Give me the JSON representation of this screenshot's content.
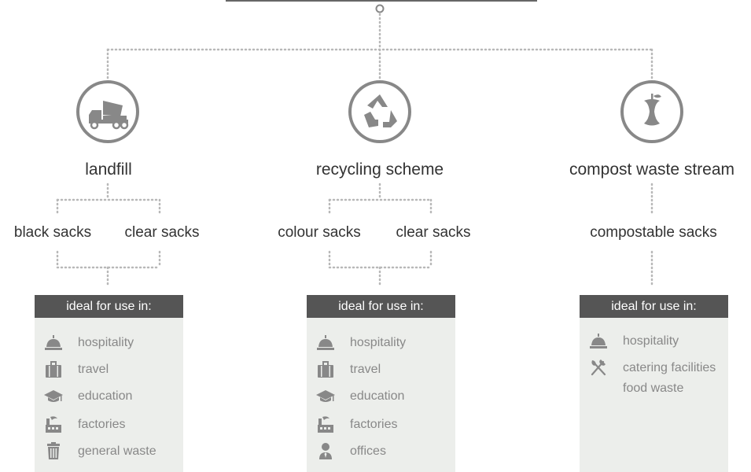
{
  "colors": {
    "dotted_line": "#b8b8b8",
    "icon": "#888888",
    "card_header_bg": "#555555",
    "card_bg": "#eceeeb",
    "item_text": "#888888"
  },
  "columns": [
    {
      "heading": "landfill",
      "icon": "dump-truck-icon",
      "sacks": [
        "black sacks",
        "clear sacks"
      ],
      "card": {
        "header": "ideal for use in:",
        "items": [
          {
            "icon": "service-bell-icon",
            "label": "hospitality"
          },
          {
            "icon": "suitcase-icon",
            "label": "travel"
          },
          {
            "icon": "graduation-cap-icon",
            "label": "education"
          },
          {
            "icon": "factory-icon",
            "label": "factories"
          },
          {
            "icon": "trash-bin-icon",
            "label": "general waste"
          }
        ]
      }
    },
    {
      "heading": "recycling scheme",
      "icon": "recycle-icon",
      "sacks": [
        "colour sacks",
        "clear sacks"
      ],
      "card": {
        "header": "ideal for use in:",
        "items": [
          {
            "icon": "service-bell-icon",
            "label": "hospitality"
          },
          {
            "icon": "suitcase-icon",
            "label": "travel"
          },
          {
            "icon": "graduation-cap-icon",
            "label": "education"
          },
          {
            "icon": "factory-icon",
            "label": "factories"
          },
          {
            "icon": "office-worker-icon",
            "label": "offices"
          }
        ]
      }
    },
    {
      "heading": "compost waste stream",
      "icon": "apple-core-icon",
      "sacks": [
        "compostable sacks"
      ],
      "card": {
        "header": "ideal for use in:",
        "items": [
          {
            "icon": "service-bell-icon",
            "label": "hospitality"
          },
          {
            "icon": "fork-knife-icon",
            "label": "catering facilities food waste"
          }
        ]
      }
    }
  ]
}
